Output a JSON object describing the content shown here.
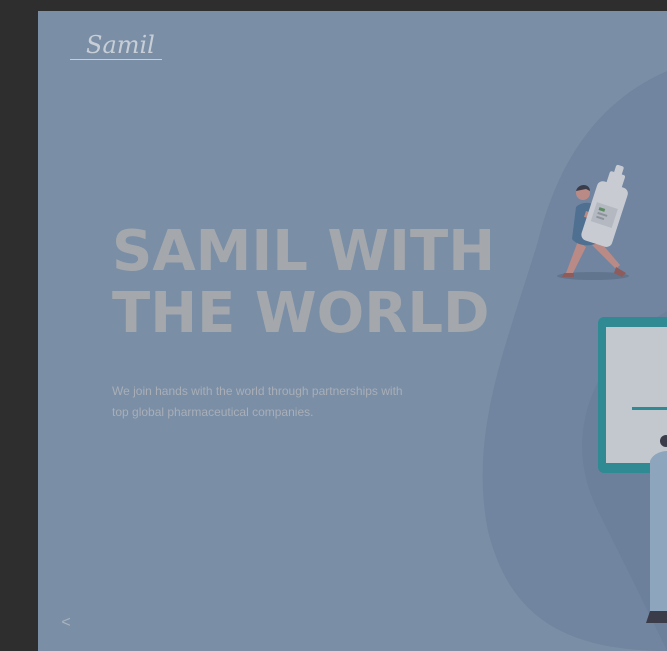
{
  "brand": {
    "logo_text": "Samil"
  },
  "hero": {
    "headline_line1": "SAMIL WITH",
    "headline_line2": "THE WORLD",
    "subtitle_line1": "We join hands with the world through partnerships with",
    "subtitle_line2": "top global pharmaceutical companies."
  },
  "carousel": {
    "prev_icon": "chevron-left-icon",
    "prev_glyph": "<"
  },
  "colors": {
    "page_bg": "#2e2e2e",
    "hero_bg": "#7a8ea6",
    "headline": "#a4a8ad",
    "accent_teal": "#2f8a93"
  }
}
